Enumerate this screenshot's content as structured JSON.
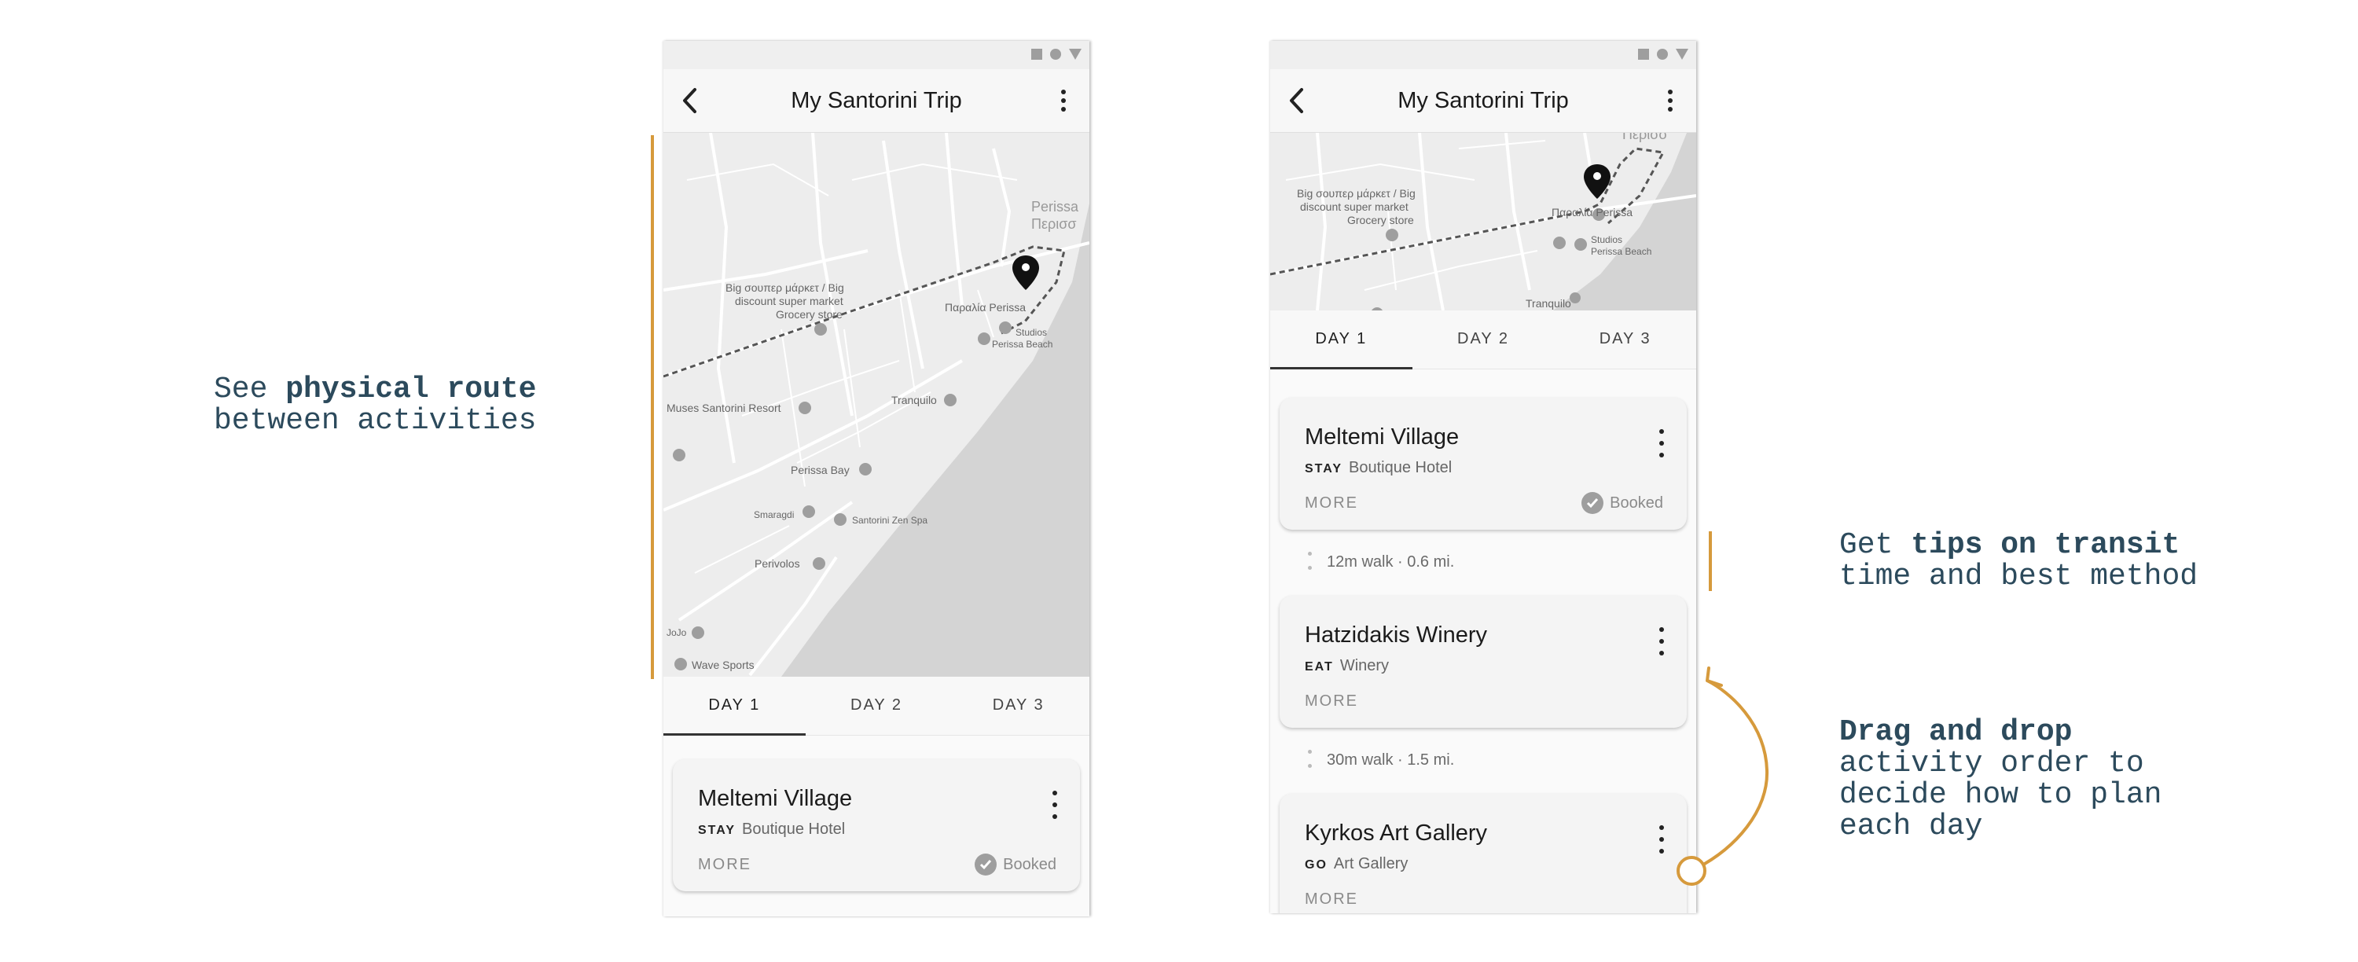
{
  "annotations": {
    "route": {
      "prefix": "See ",
      "bold": "physical route",
      "line2": "between activities"
    },
    "transit": {
      "prefix": "Get ",
      "bold": "tips on transit",
      "line2": "time and best method"
    },
    "drag": {
      "bold": "Drag and drop",
      "line2": "activity order to",
      "line3": "decide how to plan",
      "line4": "each day"
    }
  },
  "colors": {
    "accent": "#d69a3c",
    "annotation_text": "#2c4a5c",
    "water": "#d4d4d4",
    "land": "#ededed",
    "road": "#ffffff"
  },
  "icons": {
    "back": "arrow-back-icon",
    "menu": "more-vert-icon",
    "booked": "check-circle-icon",
    "pin": "location-pin-icon",
    "poi": "poi-marker-icon"
  },
  "phones": [
    {
      "title": "My Santorini Trip",
      "tabs": [
        "DAY 1",
        "DAY 2",
        "DAY 3"
      ],
      "active_tab": 0,
      "map_labels": [
        {
          "text": "Big σουπερ μάρκετ / Big"
        },
        {
          "text": "discount super market"
        },
        {
          "text": "Grocery store"
        },
        {
          "text": "Παραλία Perissa"
        },
        {
          "text": "Studios"
        },
        {
          "text": "Perissa Beach"
        },
        {
          "text": "Perissa"
        },
        {
          "text": "Περισσ"
        },
        {
          "text": "Muses Santorini Resort"
        },
        {
          "text": "Tranquilo"
        },
        {
          "text": "Perissa Bay"
        },
        {
          "text": "Smaragdi"
        },
        {
          "text": "Santorini Zen Spa"
        },
        {
          "text": "Perivolos"
        },
        {
          "text": "JoJo"
        },
        {
          "text": "Wave Sports"
        }
      ],
      "cards": [
        {
          "name": "Meltemi Village",
          "type": "STAY",
          "category": "Boutique Hotel",
          "more": "MORE",
          "status": "Booked"
        }
      ]
    },
    {
      "title": "My Santorini Trip",
      "tabs": [
        "DAY 1",
        "DAY 2",
        "DAY 3"
      ],
      "active_tab": 0,
      "map_labels": [
        {
          "text": "Περισσ"
        },
        {
          "text": "Big σουπερ μάρκετ / Big"
        },
        {
          "text": "discount super market"
        },
        {
          "text": "Grocery store"
        },
        {
          "text": "Παραλία Perissa"
        },
        {
          "text": "Studios"
        },
        {
          "text": "Perissa Beach"
        },
        {
          "text": "Tranquilo"
        }
      ],
      "cards": [
        {
          "name": "Meltemi Village",
          "type": "STAY",
          "category": "Boutique Hotel",
          "more": "MORE",
          "status": "Booked"
        },
        {
          "name": "Hatzidakis Winery",
          "type": "EAT",
          "category": "Winery",
          "more": "MORE"
        },
        {
          "name": "Kyrkos Art Gallery",
          "type": "GO",
          "category": "Art Gallery",
          "more": "MORE"
        }
      ],
      "transit": [
        "12m walk · 0.6 mi.",
        "30m walk · 1.5 mi."
      ]
    }
  ]
}
